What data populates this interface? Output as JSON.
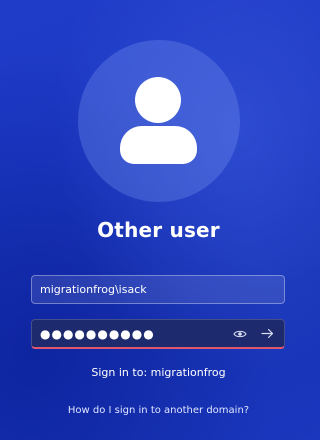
{
  "user": {
    "display_name": "Other user"
  },
  "form": {
    "username_value": "migrationfrog\\isack",
    "password_masked": "●●●●●●●●●●",
    "reveal_icon": "eye-icon",
    "submit_icon": "arrow-right-icon"
  },
  "footer": {
    "sign_in_to": "Sign in to: migrationfrog",
    "other_domain_link": "How do I sign in to another domain?"
  },
  "colors": {
    "background": "#1c39c3",
    "avatar_halo": "#7896f0",
    "password_underline": "#e0566a"
  }
}
